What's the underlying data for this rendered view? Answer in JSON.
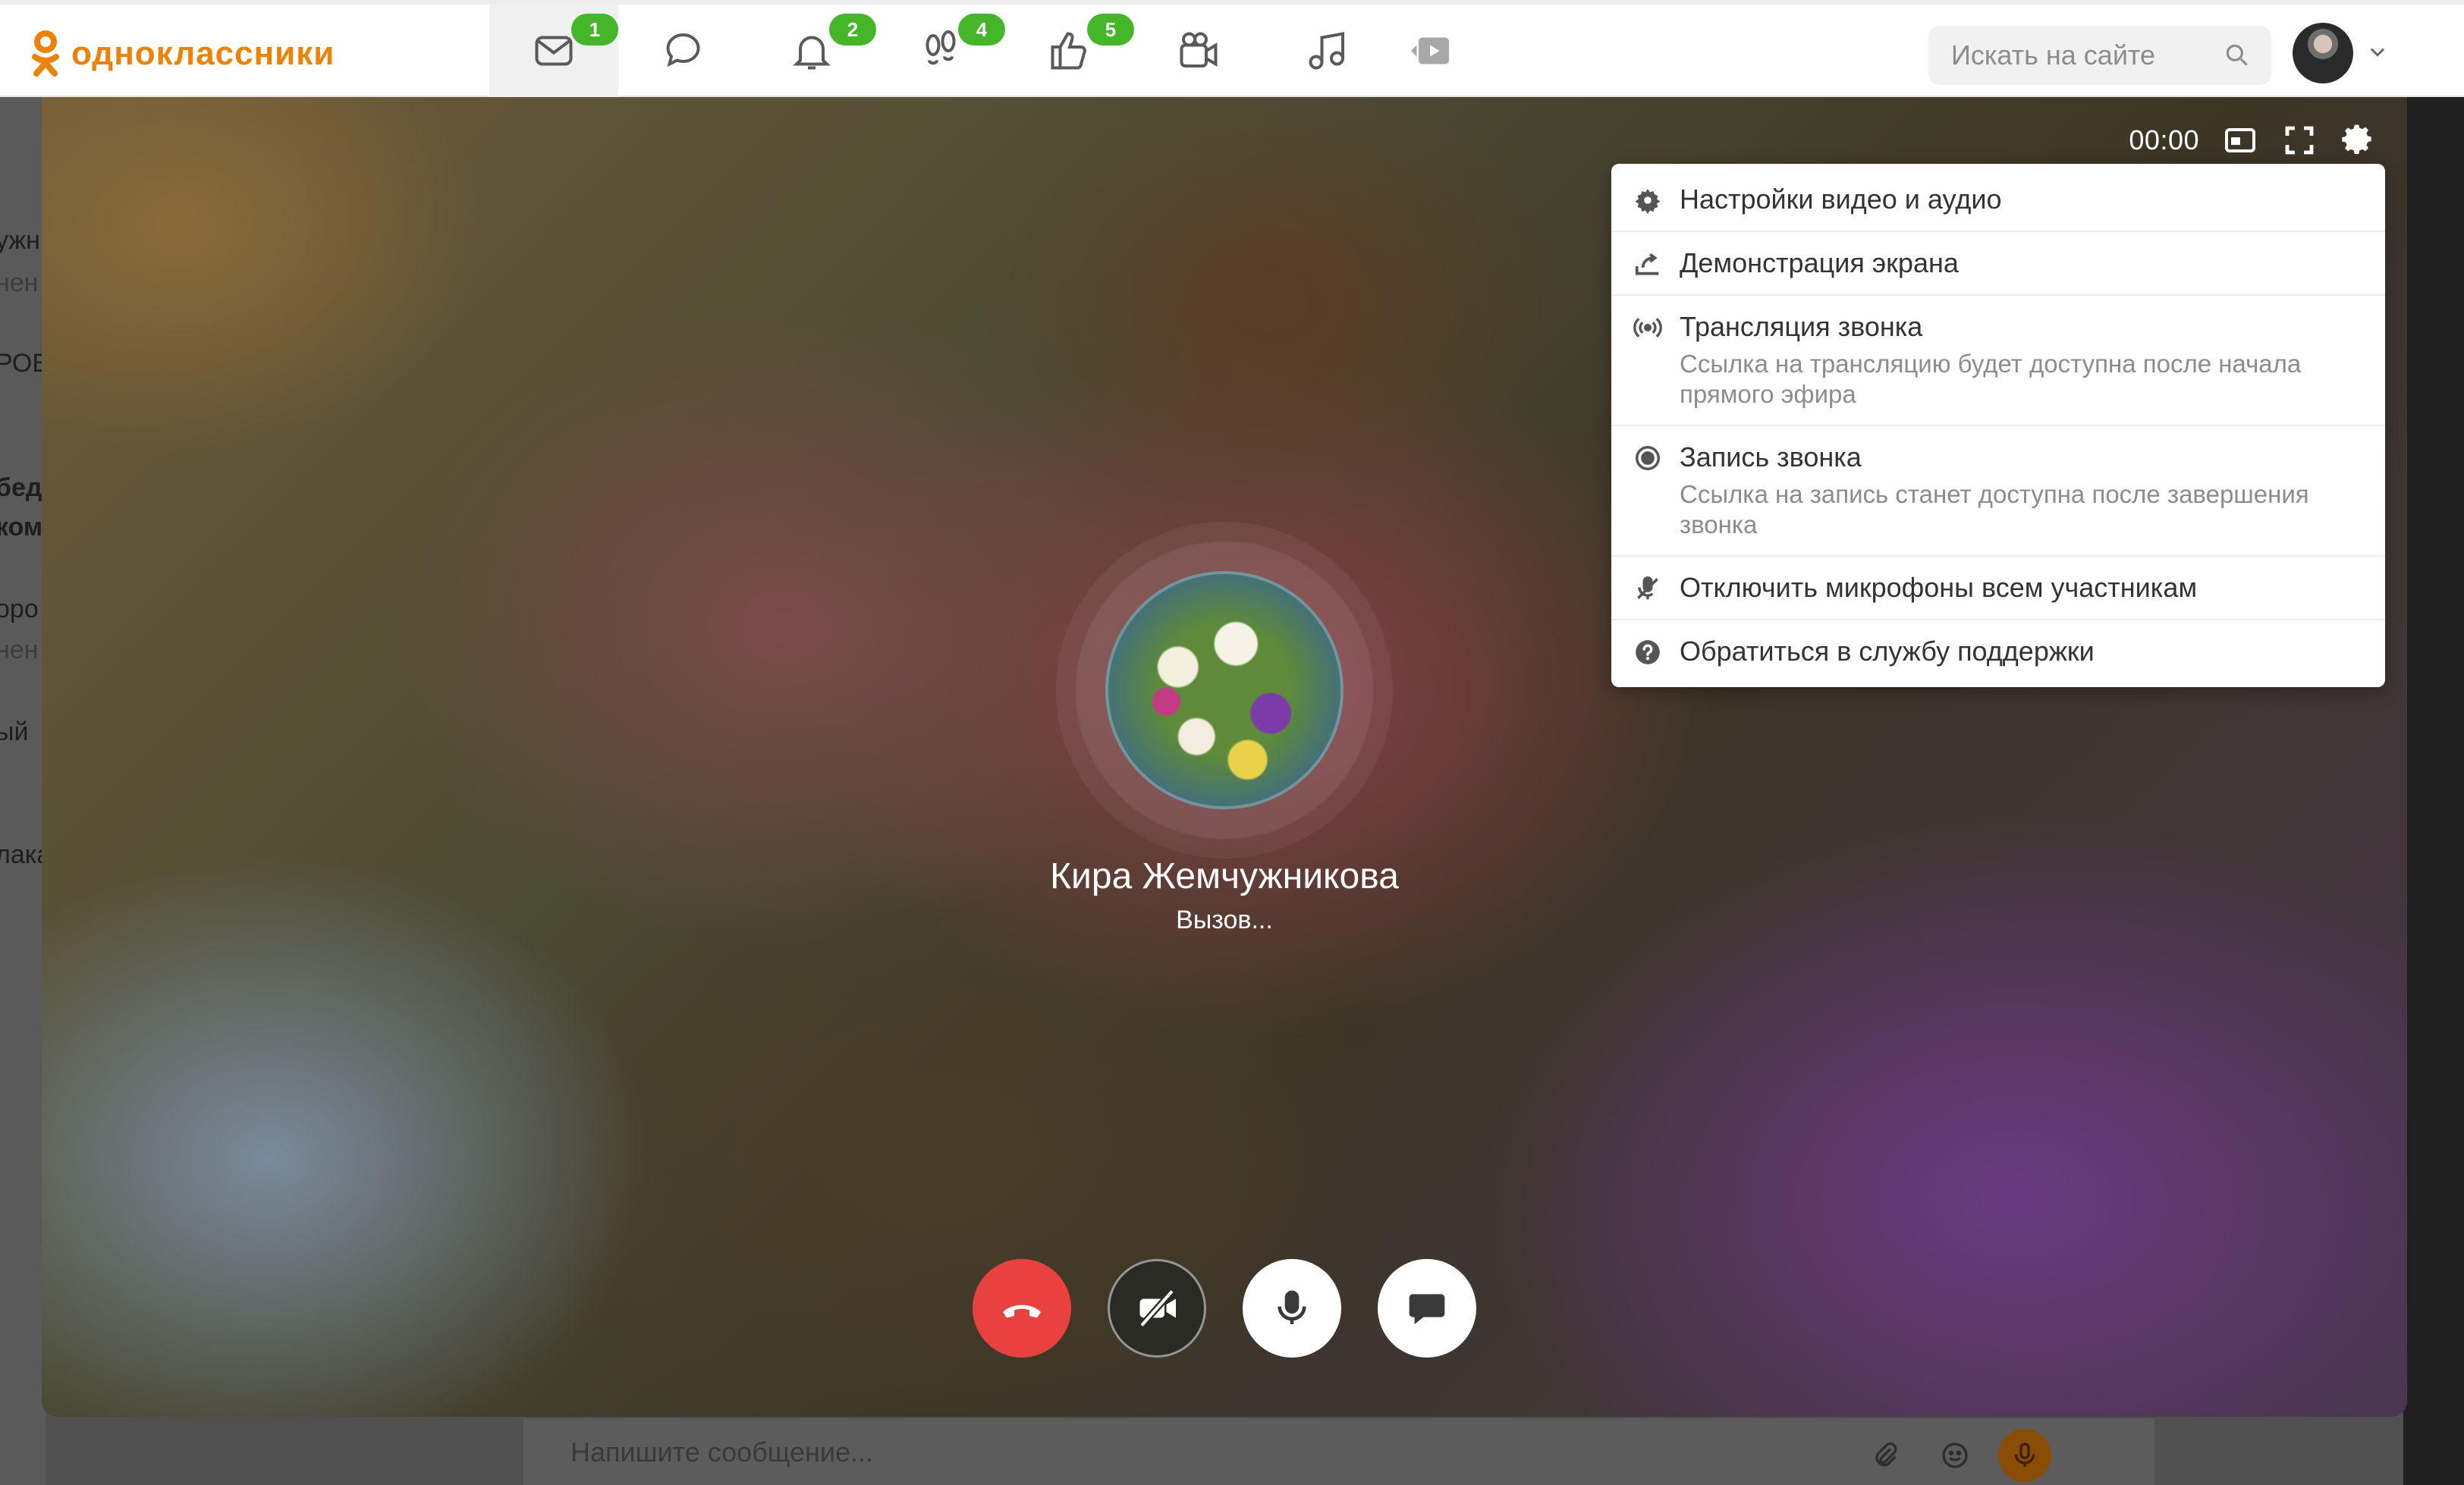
{
  "header": {
    "logo_text": "одноклассники",
    "brand_color": "#ee8208",
    "nav": [
      {
        "name": "messages",
        "icon": "envelope-icon",
        "badge": "1"
      },
      {
        "name": "discussions",
        "icon": "speech-bubble-icon",
        "badge": ""
      },
      {
        "name": "notifications",
        "icon": "bell-icon",
        "badge": "2"
      },
      {
        "name": "guests",
        "icon": "footprints-icon",
        "badge": "4"
      },
      {
        "name": "events",
        "icon": "thumbs-up-icon",
        "badge": "5"
      },
      {
        "name": "video",
        "icon": "video-camera-icon",
        "badge": ""
      },
      {
        "name": "music",
        "icon": "music-note-icon",
        "badge": ""
      },
      {
        "name": "video-showcase",
        "icon": "play-icon",
        "badge": ""
      }
    ],
    "badge_color": "#45b52a",
    "search": {
      "placeholder": "Искать на сайте"
    }
  },
  "background_page": {
    "left_fragments": [
      "ужн",
      "нен",
      "РОВ",
      "бед",
      "ком",
      "оро",
      "нен",
      "ый",
      "лака"
    ],
    "composer_placeholder": "Напишите сообщение..."
  },
  "call": {
    "timer": "00:00",
    "callee_name": "Кира Жемчужникова",
    "status": "Вызов...",
    "menu": [
      {
        "label": "Настройки видео и аудио",
        "icon": "gear-icon",
        "sub": ""
      },
      {
        "label": "Демонстрация экрана",
        "icon": "screen-share-icon",
        "sub": ""
      },
      {
        "label": "Трансляция звонка",
        "icon": "broadcast-icon",
        "sub": "Ссылка на трансляцию будет доступна после начала прямого эфира"
      },
      {
        "label": "Запись звонка",
        "icon": "record-icon",
        "sub": "Ссылка на запись станет доступна после завершения звонка"
      },
      {
        "label": "Отключить микрофоны всем участникам",
        "icon": "mic-off-icon",
        "sub": ""
      },
      {
        "label": "Обратиться в службу поддержки",
        "icon": "help-icon",
        "sub": ""
      }
    ],
    "controls": [
      "hangup",
      "camera-off",
      "microphone",
      "chat"
    ],
    "hangup_color": "#e8413f"
  }
}
